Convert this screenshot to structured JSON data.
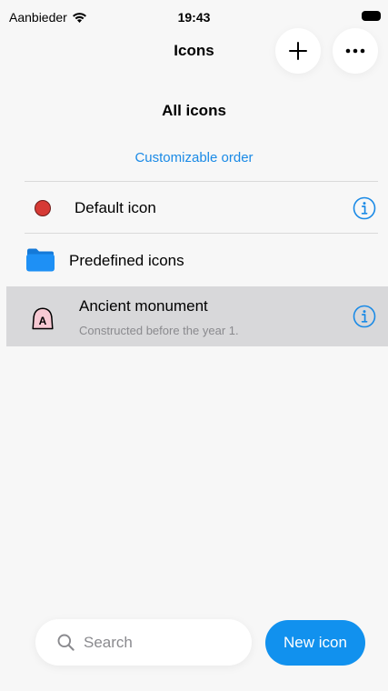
{
  "status_bar": {
    "carrier": "Aanbieder",
    "time": "19:43"
  },
  "nav": {
    "title": "Icons",
    "add_icon": "plus-icon",
    "more_icon": "ellipsis-icon"
  },
  "content": {
    "section_title": "All icons",
    "order_link": "Customizable order",
    "rows": [
      {
        "label": "Default icon",
        "icon": "red-circle-icon",
        "has_info": true
      },
      {
        "label": "Predefined icons",
        "icon": "folder-icon",
        "has_info": false
      },
      {
        "label": "Ancient monument",
        "subtitle": "Constructed before the year 1.",
        "icon": "monument-icon",
        "badge_letter": "A",
        "has_info": true,
        "selected": true
      }
    ]
  },
  "bottom": {
    "search_placeholder": "Search",
    "new_button": "New icon"
  },
  "colors": {
    "accent": "#1a8ae6",
    "button": "#1191ee",
    "red_dot": "#d63a35",
    "selected_bg": "#d8d8da",
    "monument_fill": "#f7c9d3"
  }
}
